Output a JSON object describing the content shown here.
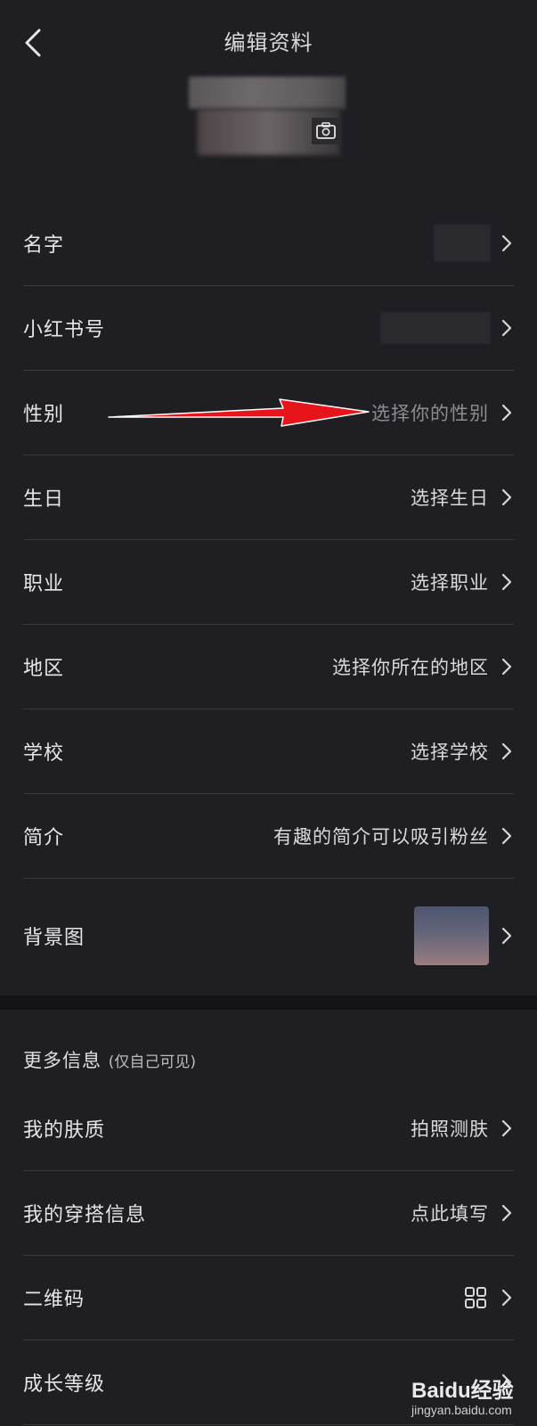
{
  "header": {
    "title": "编辑资料"
  },
  "profile_rows": [
    {
      "label": "名字",
      "value": ""
    },
    {
      "label": "小红书号",
      "value": ""
    },
    {
      "label": "性别",
      "value": "选择你的性别"
    },
    {
      "label": "生日",
      "value": "选择生日"
    },
    {
      "label": "职业",
      "value": "选择职业"
    },
    {
      "label": "地区",
      "value": "选择你所在的地区"
    },
    {
      "label": "学校",
      "value": "选择学校"
    },
    {
      "label": "简介",
      "value": "有趣的简介可以吸引粉丝"
    },
    {
      "label": "背景图",
      "value": ""
    }
  ],
  "more_section": {
    "title": "更多信息",
    "subtitle": "(仅自己可见)",
    "rows": [
      {
        "label": "我的肤质",
        "value": "拍照测肤"
      },
      {
        "label": "我的穿搭信息",
        "value": "点此填写"
      },
      {
        "label": "二维码",
        "icon": "qr-code-icon"
      },
      {
        "label": "成长等级",
        "value": ""
      }
    ]
  },
  "watermark": {
    "text": "Baidu经验",
    "url": "jingyan.baidu.com"
  },
  "colors": {
    "background": "#1f1e23",
    "arrow": "#e8141c",
    "divider": "#141417"
  },
  "icons": {
    "back": "chevron-left-icon",
    "row": "chevron-right-icon",
    "avatar": "camera-icon"
  }
}
